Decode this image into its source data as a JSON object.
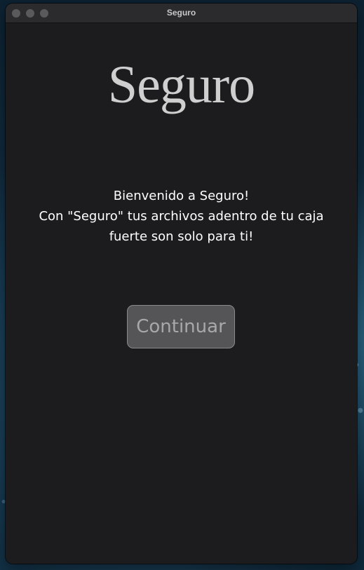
{
  "window": {
    "title": "Seguro"
  },
  "app": {
    "logo_text": "Seguro",
    "welcome_line1": "Bienvenido a Seguro!",
    "welcome_line2": "Con \"Seguro\" tus archivos adentro de tu caja",
    "welcome_line3": "fuerte son solo para ti!",
    "continue_label": "Continuar"
  },
  "colors": {
    "window_background": "#1c1c1e",
    "titlebar_background": "#2b2b2d",
    "button_background": "#555557",
    "button_border": "#8a8a8a",
    "logo_text": "#cfcfcf",
    "body_text": "#ffffff"
  }
}
